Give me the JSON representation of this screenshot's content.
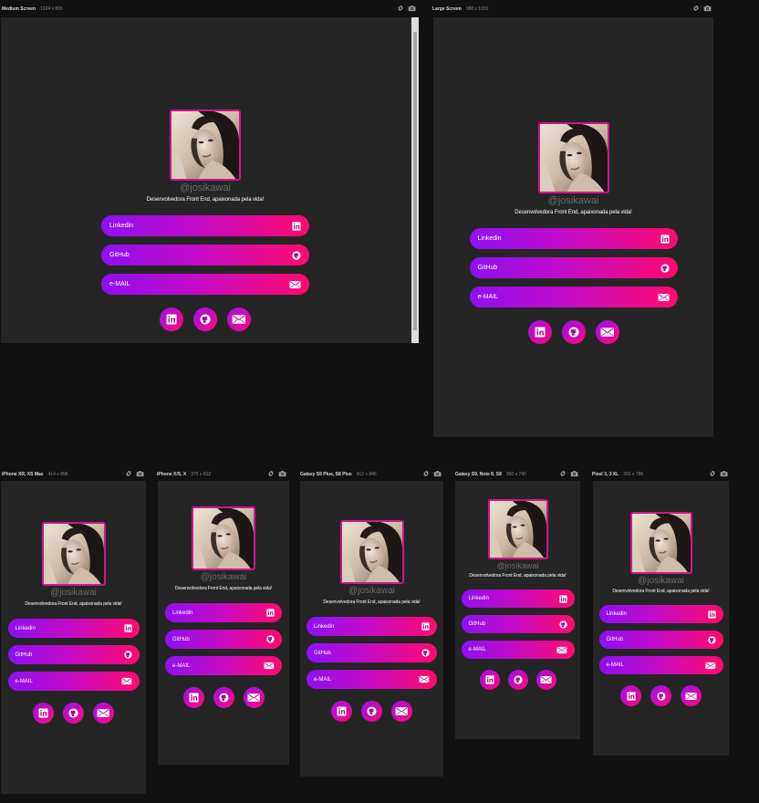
{
  "profile": {
    "handle": "@josikawai",
    "bio": "Desenvolvedora Front End, apaixonada pela vida!",
    "links": [
      {
        "label": "Linkedin",
        "icon": "linkedin-icon"
      },
      {
        "label": "GitHub",
        "icon": "github-icon"
      },
      {
        "label": "e-MAIL",
        "icon": "mail-icon"
      }
    ]
  },
  "devices": [
    {
      "name": "Medium Screen",
      "size": "1024 x 809"
    },
    {
      "name": "Large Screen",
      "size": "988 x 1031"
    },
    {
      "name": "iPhone XR, XS Max",
      "size": "414 x 896"
    },
    {
      "name": "iPhone X/S, X",
      "size": "375 x 812"
    },
    {
      "name": "Galaxy S9 Plus, S8 Plus",
      "size": "412 x 846"
    },
    {
      "name": "Galaxy S9, Note 8, S8",
      "size": "360 x 740"
    },
    {
      "name": "Pixel 3, 3 XL",
      "size": "393 x 786"
    }
  ],
  "colors": {
    "gradient_start": "#8e10f0",
    "gradient_end": "#ff0b6c",
    "photo_border": "#d4148c",
    "panel_bg": "#252526",
    "app_bg": "#111111"
  }
}
